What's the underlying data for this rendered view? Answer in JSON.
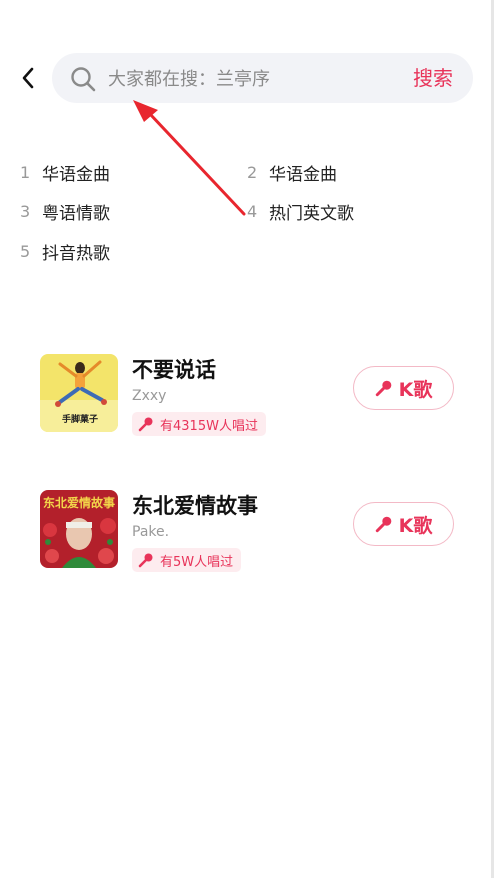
{
  "header": {
    "search_placeholder": "大家都在搜：兰亭序",
    "search_button": "搜索"
  },
  "hot_list": [
    {
      "rank": "1",
      "label": "华语金曲"
    },
    {
      "rank": "2",
      "label": "华语金曲"
    },
    {
      "rank": "3",
      "label": "粤语情歌"
    },
    {
      "rank": "4",
      "label": "热门英文歌"
    },
    {
      "rank": "5",
      "label": "抖音热歌"
    }
  ],
  "songs": [
    {
      "title": "不要说话",
      "artist": "Zxxy",
      "sing_count": "有4315W人唱过",
      "button": "K歌",
      "cover_text": "手脚菓子"
    },
    {
      "title": "东北爱情故事",
      "artist": "Pake.",
      "sing_count": "有5W人唱过",
      "button": "K歌",
      "cover_text": "东北爱情故事"
    }
  ],
  "colors": {
    "accent": "#e8345a",
    "search_bg": "#f2f3f7",
    "badge_bg": "#fdecef",
    "annotation_arrow": "#e8262e"
  },
  "icons": {
    "back": "chevron-left-icon",
    "search": "magnifier-icon",
    "microphone": "microphone-icon"
  }
}
